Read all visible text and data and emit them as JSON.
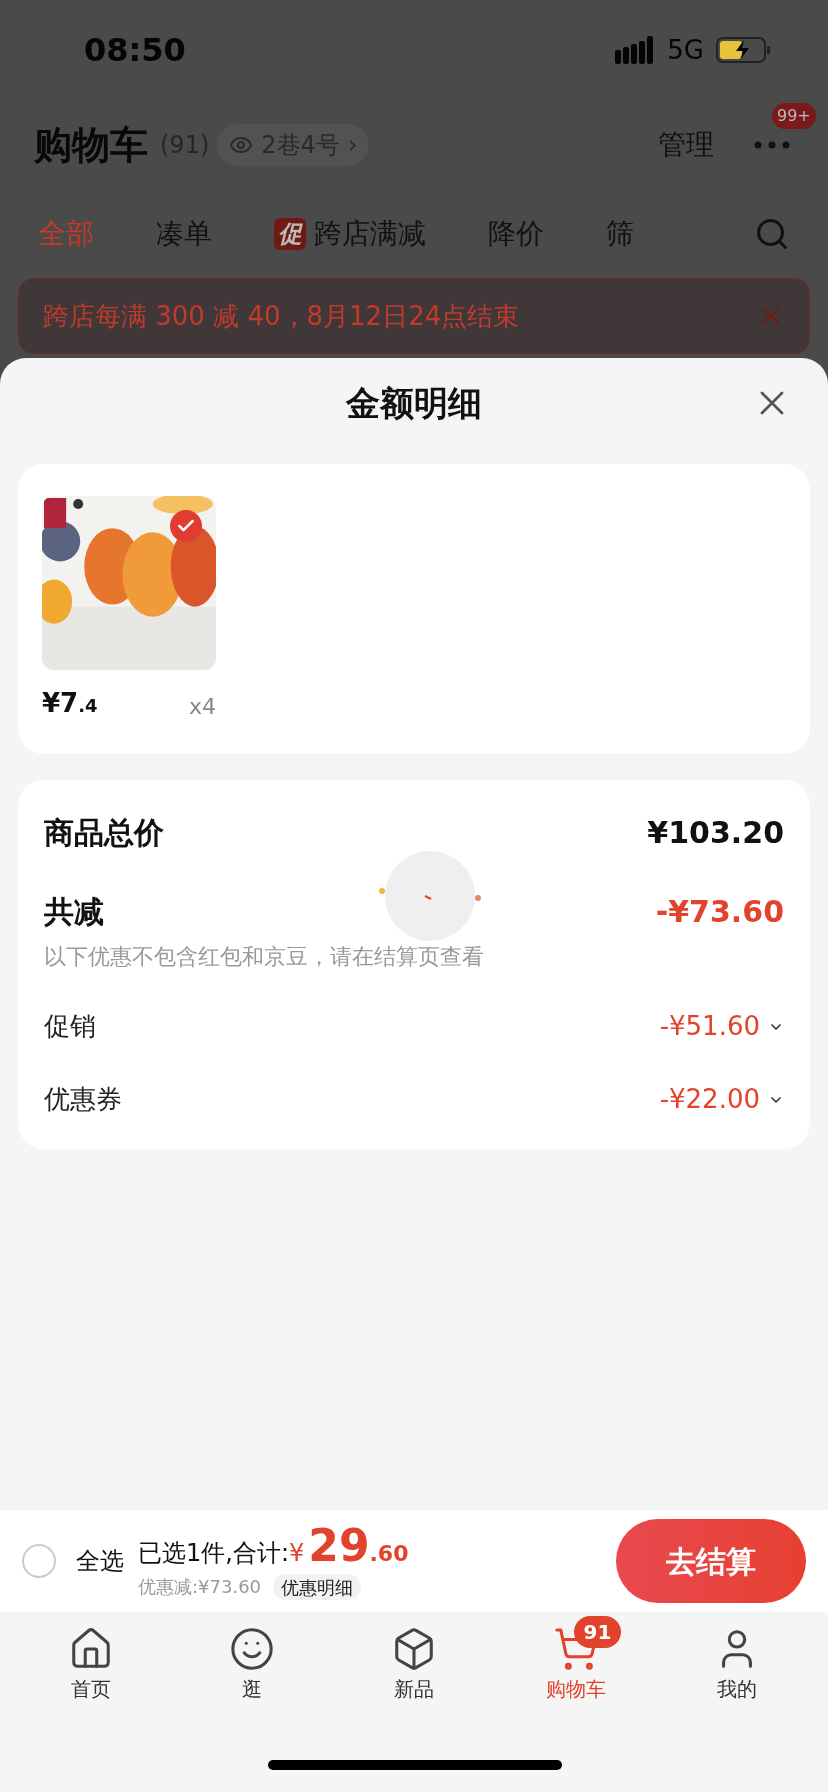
{
  "status_bar": {
    "time": "08:50",
    "network": "5G"
  },
  "header": {
    "title": "购物车",
    "count": "(91)",
    "address": "2巷4号",
    "address_arrow": "›",
    "manage": "管理",
    "more_badge": "99+"
  },
  "tabs": [
    {
      "label": "全部",
      "selected": true
    },
    {
      "label": "凑单",
      "selected": false
    },
    {
      "label": "跨店满减",
      "badge": "促",
      "selected": false
    },
    {
      "label": "降价",
      "selected": false
    },
    {
      "label": "筛",
      "selected": false
    }
  ],
  "promo_banner": {
    "text": "跨店每满 300 减 40，8月12日24点结束"
  },
  "sheet": {
    "title": "金额明细",
    "products": [
      {
        "kind": "picture",
        "checked": true,
        "price_integer": "¥7",
        "price_decimal": ".4",
        "quantity": "x4"
      }
    ],
    "summary": {
      "total_label": "商品总价",
      "total_value": "¥103.20",
      "discount_label": "共减",
      "discount_value": "-¥73.60",
      "note": "以下优惠不包含红包和京豆，请在结算页查看",
      "items": [
        {
          "label": "促销",
          "value": "-¥51.60",
          "expanded": false
        },
        {
          "label": "优惠券",
          "value": "-¥22.00",
          "expanded": false
        }
      ]
    },
    "loading": true
  },
  "checkout_bar": {
    "select_all": {
      "label": "全选",
      "checked": false
    },
    "selected_text": "已选1件,合计:",
    "currency": "¥",
    "total_integer": "29",
    "total_decimal": ".60",
    "discount_text": "优惠减:¥73.60",
    "details_button": "优惠明细",
    "checkout_button": "去结算"
  },
  "nav": [
    {
      "kind": "home",
      "label": "首页",
      "selected": false
    },
    {
      "kind": "browse",
      "label": "逛",
      "selected": false
    },
    {
      "kind": "new",
      "label": "新品",
      "selected": false
    },
    {
      "kind": "cart",
      "label": "购物车",
      "selected": true,
      "badge": "91"
    },
    {
      "kind": "profile",
      "label": "我的",
      "selected": false
    }
  ]
}
